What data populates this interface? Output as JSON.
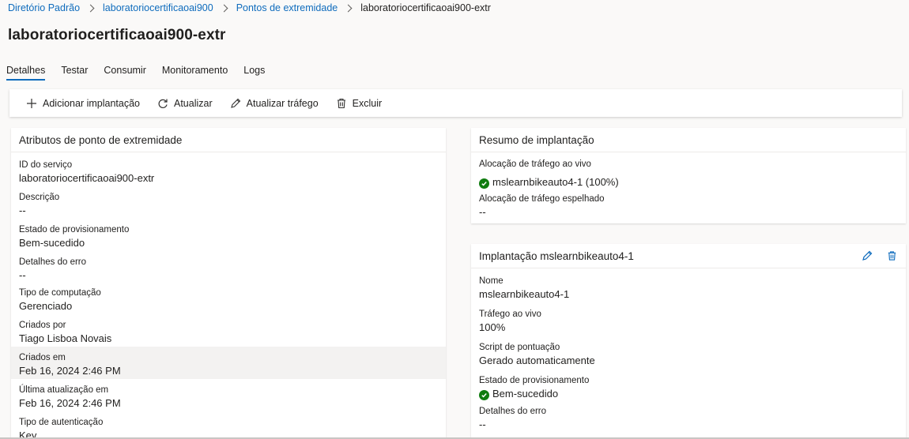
{
  "breadcrumb": {
    "items": [
      "Diretório Padrão",
      "laboratoriocertificaoai900",
      "Pontos de extremidade"
    ],
    "current": "laboratoriocertificaoai900-extr"
  },
  "page_title": "laboratoriocertificaoai900-extr",
  "tabs": [
    {
      "label": "Detalhes",
      "active": true
    },
    {
      "label": "Testar"
    },
    {
      "label": "Consumir"
    },
    {
      "label": "Monitoramento"
    },
    {
      "label": "Logs"
    }
  ],
  "toolbar": {
    "add": {
      "label": "Adicionar implantação",
      "icon": "plus-icon"
    },
    "refresh": {
      "label": "Atualizar",
      "icon": "refresh-icon"
    },
    "traffic": {
      "label": "Atualizar tráfego",
      "icon": "pencil-icon"
    },
    "delete": {
      "label": "Excluir",
      "icon": "trash-icon"
    }
  },
  "attributes": {
    "title": "Atributos de ponto de extremidade",
    "fields": [
      {
        "label": "ID do serviço",
        "value": "laboratoriocertificaoai900-extr"
      },
      {
        "label": "Descrição",
        "value": "--"
      },
      {
        "label": "Estado de provisionamento",
        "value": "Bem-sucedido"
      },
      {
        "label": "Detalhes do erro",
        "value": "--"
      },
      {
        "label": "Tipo de computação",
        "value": "Gerenciado"
      },
      {
        "label": "Criados por",
        "value": "Tiago Lisboa Novais"
      },
      {
        "label": "Criados em",
        "value": "Feb 16, 2024 2:46 PM"
      },
      {
        "label": "Última atualização em",
        "value": "Feb 16, 2024 2:46 PM"
      },
      {
        "label": "Tipo de autenticação",
        "value": "Key"
      }
    ]
  },
  "summary": {
    "title": "Resumo de implantação",
    "live_label": "Alocação de tráfego ao vivo",
    "live_value": "mslearnbikeauto4-1 (100%)",
    "mirror_label": "Alocação de tráfego espelhado",
    "mirror_value": "--"
  },
  "deployment": {
    "title": "Implantação mslearnbikeauto4-1",
    "fields": [
      {
        "label": "Nome",
        "value": "mslearnbikeauto4-1"
      },
      {
        "label": "Tráfego ao vivo",
        "value": "100%"
      },
      {
        "label": "Script de pontuação",
        "value": "Gerado automaticamente"
      },
      {
        "label": "Estado de provisionamento",
        "value": "Bem-sucedido"
      },
      {
        "label": "Detalhes do erro",
        "value": "--"
      }
    ]
  },
  "colors": {
    "accent": "#0f6cbd",
    "success": "#107c10"
  }
}
